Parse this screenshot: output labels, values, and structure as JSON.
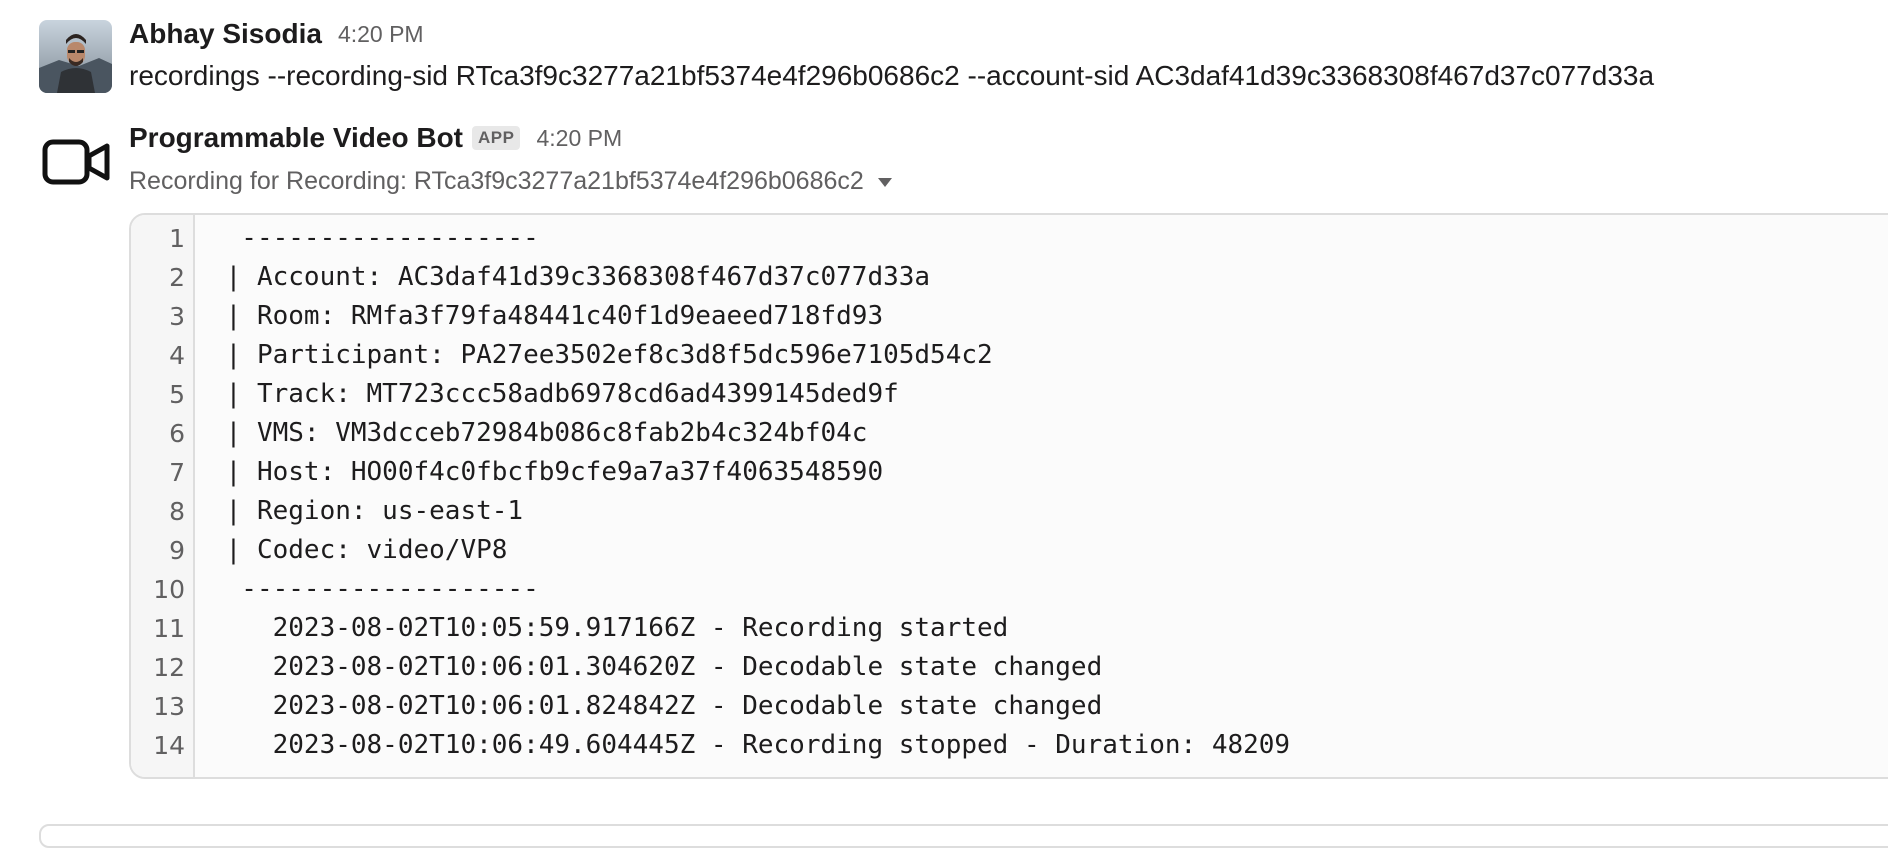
{
  "message1": {
    "sender": "Abhay Sisodia",
    "time": "4:20 PM",
    "text": "recordings --recording-sid RTca3f9c3277a21bf5374e4f296b0686c2 --account-sid AC3daf41d39c3368308f467d37c077d33a"
  },
  "message2": {
    "sender": "Programmable Video Bot",
    "badge": "APP",
    "time": "4:20 PM",
    "attachment_title": "Recording for Recording: RTca3f9c3277a21bf5374e4f296b0686c2",
    "code_lines": [
      {
        "n": "1",
        "text": "  -------------------"
      },
      {
        "n": "2",
        "text": " | Account: AC3daf41d39c3368308f467d37c077d33a"
      },
      {
        "n": "3",
        "text": " | Room: RMfa3f79fa48441c40f1d9eaeed718fd93"
      },
      {
        "n": "4",
        "text": " | Participant: PA27ee3502ef8c3d8f5dc596e7105d54c2"
      },
      {
        "n": "5",
        "text": " | Track: MT723ccc58adb6978cd6ad4399145ded9f"
      },
      {
        "n": "6",
        "text": " | VMS: VM3dcceb72984b086c8fab2b4c324bf04c"
      },
      {
        "n": "7",
        "text": " | Host: HO00f4c0fbcfb9cfe9a7a37f4063548590"
      },
      {
        "n": "8",
        "text": " | Region: us-east-1"
      },
      {
        "n": "9",
        "text": " | Codec: video/VP8"
      },
      {
        "n": "10",
        "text": "  -------------------"
      },
      {
        "n": "11",
        "text": "    2023-08-02T10:05:59.917166Z - Recording started"
      },
      {
        "n": "12",
        "text": "    2023-08-02T10:06:01.304620Z - Decodable state changed"
      },
      {
        "n": "13",
        "text": "    2023-08-02T10:06:01.824842Z - Decodable state changed"
      },
      {
        "n": "14",
        "text": "    2023-08-02T10:06:49.604445Z - Recording stopped - Duration: 48209"
      }
    ]
  }
}
